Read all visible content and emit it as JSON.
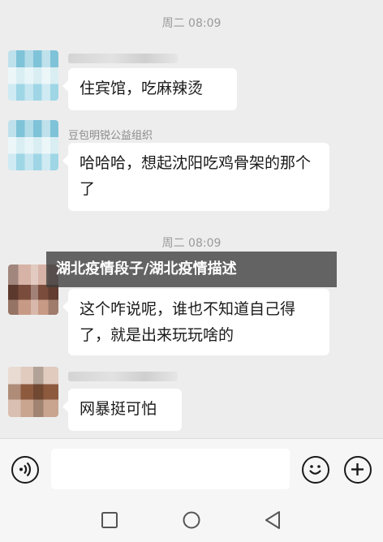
{
  "messages": [
    {
      "time": "周二 08:09"
    },
    {
      "sender": "",
      "text": "住宾馆，吃麻辣烫",
      "avatar": "blurred-avatar"
    },
    {
      "sender": "豆包明锐公益组织",
      "text": "哈哈哈，想起沈阳吃鸡骨架的那个了",
      "avatar": "blurred-avatar"
    },
    {
      "time": "周二 08:09"
    },
    {
      "sender": "",
      "text": "这个咋说呢，谁也不知道自己得了，就是出来玩玩啥的",
      "avatar": "blurred-avatar"
    },
    {
      "sender": "",
      "text": "网暴挺可怕",
      "avatar": "blurred-avatar"
    }
  ],
  "overlay_title": "湖北疫情段子/湖北疫情描述",
  "input": {
    "value": "",
    "placeholder": ""
  },
  "icons": [
    "voice-icon",
    "emoji-icon",
    "plus-icon",
    "square-nav-icon",
    "circle-nav-icon",
    "back-triangle-icon"
  ],
  "colors": {
    "chat_background": "#ededed",
    "bubble": "#ffffff",
    "overlay": "#3c3c3c"
  }
}
